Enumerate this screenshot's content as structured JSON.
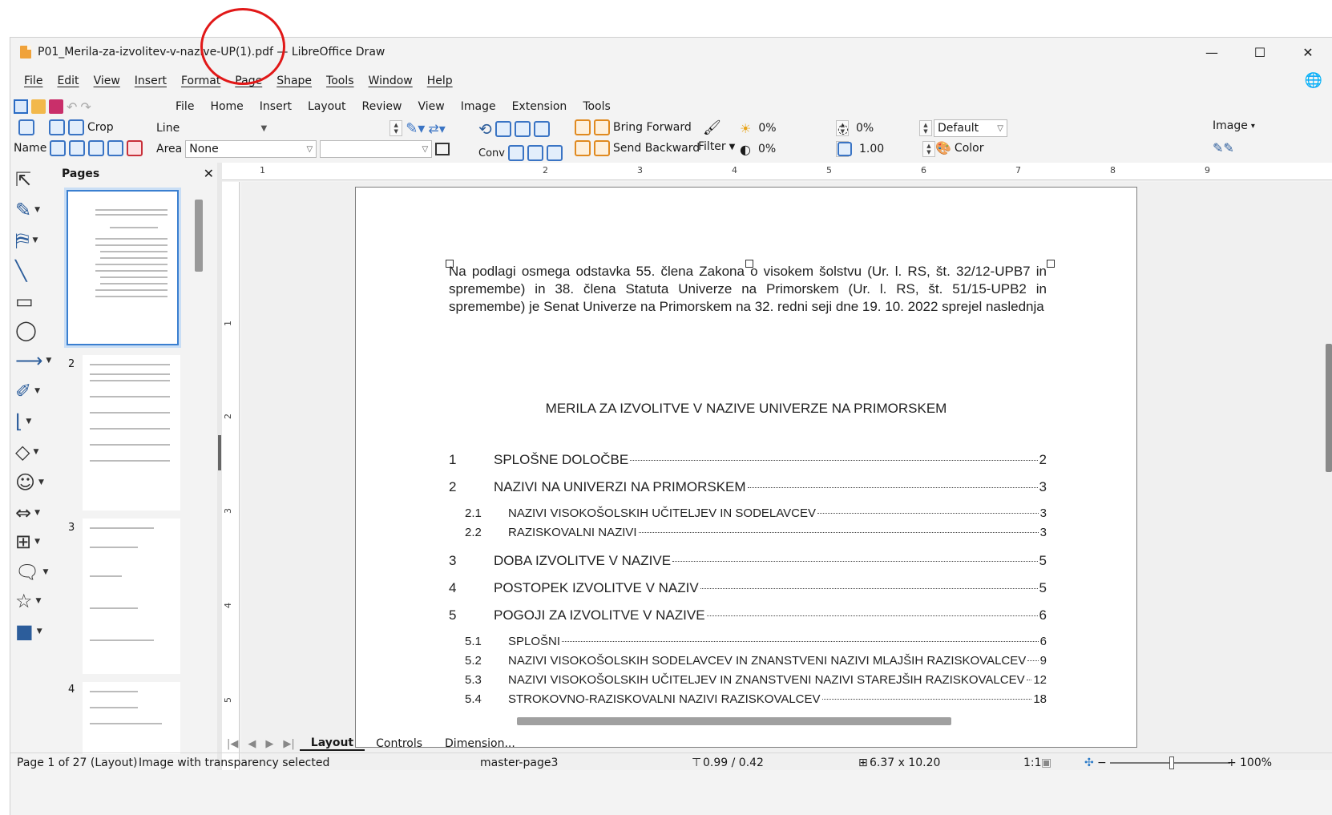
{
  "window": {
    "title": "P01_Merila-za-izvolitev-v-nazive-UP(1).pdf — LibreOffice Draw",
    "minimize": "—",
    "maximize": "☐",
    "close": "✕"
  },
  "menubar": {
    "items": [
      "File",
      "Edit",
      "View",
      "Insert",
      "Format",
      "Page",
      "Shape",
      "Tools",
      "Window",
      "Help"
    ],
    "globe_icon": "globe-icon"
  },
  "tabs": {
    "items": [
      "File",
      "Home",
      "Insert",
      "Layout",
      "Review",
      "View",
      "Image",
      "Extension",
      "Tools"
    ],
    "active": "Image"
  },
  "ribbon": {
    "crop": "Crop",
    "name": "Name",
    "line_label": "Line",
    "area_label": "Area",
    "area_value": "None",
    "conv": "Conv",
    "bring_forward": "Bring Forward",
    "send_backward": "Send Backward",
    "filter": "Filter",
    "brightness": "0%",
    "contrast": "0%",
    "red": "0%",
    "gamma": "1.00",
    "mode": "Default",
    "color": "Color",
    "image": "Image"
  },
  "pages_panel": {
    "title": "Pages",
    "close": "✕",
    "page_numbers": [
      "1",
      "2",
      "3",
      "4"
    ]
  },
  "ruler": {
    "top_marks": [
      "1",
      "2",
      "3",
      "4",
      "5",
      "6",
      "7",
      "8",
      "9"
    ],
    "left_marks": [
      "1",
      "2",
      "3",
      "4",
      "5"
    ]
  },
  "document": {
    "paragraph": "Na podlagi osmega odstavka 55. člena Zakona o visokem šolstvu (Ur. l. RS, št. 32/12-UPB7 in spremembe) in 38. člena Statuta Univerze na Primorskem (Ur. l. RS, št. 51/15-UPB2 in spremembe) je Senat Univerze na Primorskem na 32. redni seji dne 19. 10. 2022 sprejel naslednja",
    "heading": "MERILA ZA IZVOLITVE V NAZIVE UNIVERZE NA PRIMORSKEM",
    "toc": [
      {
        "num": "1",
        "label": "SPLOŠNE DOLOČBE",
        "page": "2",
        "level": 1
      },
      {
        "num": "2",
        "label": "NAZIVI NA UNIVERZI NA PRIMORSKEM",
        "page": "3",
        "level": 1
      },
      {
        "num": "2.1",
        "label": "NAZIVI VISOKOŠOLSKIH UČITELJEV IN SODELAVCEV",
        "page": "3",
        "level": 2
      },
      {
        "num": "2.2",
        "label": "RAZISKOVALNI NAZIVI",
        "page": "3",
        "level": 2
      },
      {
        "num": "3",
        "label": "DOBA IZVOLITVE V NAZIVE",
        "page": "5",
        "level": 1
      },
      {
        "num": "4",
        "label": "POSTOPEK IZVOLITVE V NAZIV",
        "page": "5",
        "level": 1
      },
      {
        "num": "5",
        "label": "POGOJI ZA IZVOLITVE V NAZIVE",
        "page": "6",
        "level": 1
      },
      {
        "num": "5.1",
        "label": "SPLOŠNI",
        "page": "6",
        "level": 2
      },
      {
        "num": "5.2",
        "label": "NAZIVI VISOKOŠOLSKIH SODELAVCEV IN ZNANSTVENI NAZIVI MLAJŠIH RAZISKOVALCEV",
        "page": "9",
        "level": 2
      },
      {
        "num": "5.3",
        "label": "NAZIVI VISOKOŠOLSKIH UČITELJEV IN ZNANSTVENI NAZIVI STAREJŠIH RAZISKOVALCEV",
        "page": "12",
        "level": 2
      },
      {
        "num": "5.4",
        "label": "STROKOVNO-RAZISKOVALNI NAZIVI RAZISKOVALCEV",
        "page": "18",
        "level": 2
      }
    ]
  },
  "bottom_tabs": [
    "Layout",
    "Controls",
    "Dimension..."
  ],
  "status": {
    "page": "Page 1 of 27 (Layout)",
    "selection": "Image with transparency selected",
    "master": "master-page3",
    "position": "0.99 / 0.42",
    "size": "6.37 x 10.20",
    "scale": "1:1",
    "zoom": "100%"
  }
}
